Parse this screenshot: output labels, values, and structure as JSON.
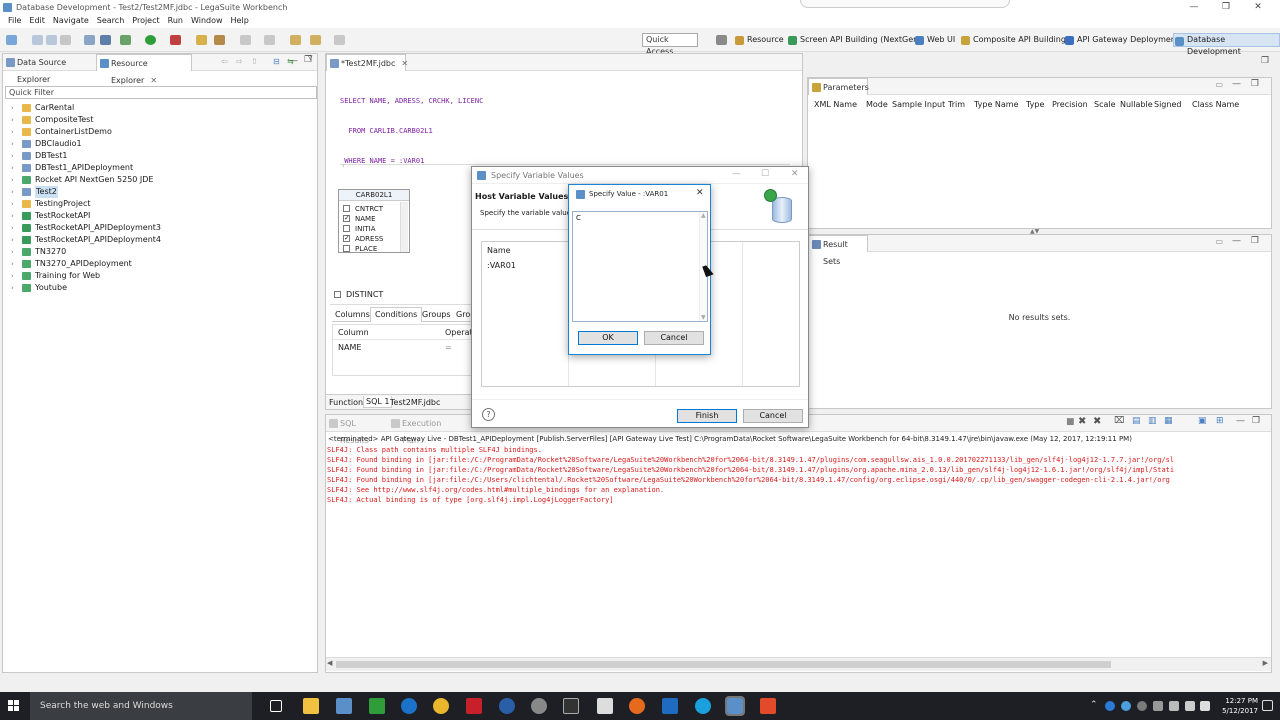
{
  "window": {
    "title": "Database Development - Test2/Test2MF.jdbc - LegaSuite Workbench",
    "minimize": "—",
    "maximize": "❐",
    "close": "✕"
  },
  "menu": [
    "File",
    "Edit",
    "Navigate",
    "Search",
    "Project",
    "Run",
    "Window",
    "Help"
  ],
  "toolbar": {
    "quick_access": "Quick Access",
    "perspectives": [
      {
        "label": "Resource",
        "color": "#c89a3a"
      },
      {
        "label": "Screen API Building (NextGen)",
        "color": "#3a9a5a"
      },
      {
        "label": "Web UI",
        "color": "#4b7fc2"
      },
      {
        "label": "Composite API Building",
        "color": "#c8a23a"
      },
      {
        "label": "API Gateway Deployment",
        "color": "#3a6fc2"
      },
      {
        "label": "Database Development",
        "color": "#5a8fc8"
      }
    ]
  },
  "left_panel": {
    "tabs": [
      "Data Source Explorer",
      "Resource Explorer"
    ],
    "quick_filter": "Quick Filter",
    "projects": [
      "CarRental",
      "CompositeTest",
      "ContainerListDemo",
      "DBClaudio1",
      "DBTest1",
      "DBTest1_APIDeployment",
      "Rocket API NextGen 5250 JDE",
      "Test2",
      "TestingProject",
      "TestRocketAPI",
      "TestRocketAPI_APIDeployment3",
      "TestRocketAPI_APIDeployment4",
      "TN3270",
      "TN3270_APIDeployment",
      "Training for Web",
      "Youtube"
    ],
    "selected_index": 7
  },
  "editor": {
    "tab": "*Test2MF.jdbc",
    "sql_lines": [
      "SELECT NAME, ADRESS, CRCHK, LICENC",
      "  FROM CARLIB.CARB02L1",
      " WHERE NAME = :VAR01"
    ],
    "table_box": {
      "title": "CARB02L1",
      "columns": [
        {
          "name": "CNTRCT",
          "checked": false
        },
        {
          "name": "NAME",
          "checked": true
        },
        {
          "name": "INITIA",
          "checked": false
        },
        {
          "name": "ADRESS",
          "checked": true
        },
        {
          "name": "PLACE",
          "checked": false
        }
      ]
    },
    "distinct_label": "DISTINCT",
    "sub_tabs": [
      "Columns",
      "Conditions",
      "Groups",
      "Grou"
    ],
    "conditions_headers": [
      "Column",
      "Operato"
    ],
    "conditions_row": [
      "NAME",
      "="
    ],
    "bottom_tabs": [
      "Function",
      "SQL 1",
      "Test2MF.jdbc"
    ]
  },
  "parameters": {
    "tab": "Parameters",
    "headers": [
      "XML Name",
      "Mode",
      "Sample Input",
      "Trim",
      "Type Name",
      "Type",
      "Precision",
      "Scale",
      "Nullable",
      "Signed",
      "Class Name"
    ]
  },
  "result_sets": {
    "tab": "Result Sets",
    "empty": "No results sets."
  },
  "console": {
    "tabs": [
      "SQL Results",
      "Execution Plan"
    ],
    "terminated": "<terminated> API Gateway Live - DBTest1_APIDeployment [Publish.ServerFiles] [API Gateway Live Test] C:\\ProgramData\\Rocket Software\\LegaSuite Workbench for 64-bit\\8.3149.1.47\\jre\\bin\\javaw.exe (May 12, 2017, 12:19:11 PM)",
    "lines": [
      "SLF4J: Class path contains multiple SLF4J bindings.",
      "SLF4J: Found binding in [jar:file:/C:/ProgramData/Rocket%20Software/LegaSuite%20Workbench%20for%2064-bit/8.3149.1.47/plugins/com.seagullsw.ais_1.0.0.201702271133/lib_gen/slf4j-log4j12-1.7.7.jar!/org/sl",
      "SLF4J: Found binding in [jar:file:/C:/ProgramData/Rocket%20Software/LegaSuite%20Workbench%20for%2064-bit/8.3149.1.47/plugins/org.apache.mina_2.0.13/lib_gen/slf4j-log4j12-1.6.1.jar!/org/slf4j/impl/Stati",
      "SLF4J: Found binding in [jar:file:/C:/Users/clichtental/.Rocket%20Software/LegaSuite%20Workbench%20for%2064-bit/8.3149.1.47/config/org.eclipse.osgi/440/0/.cp/lib_gen/swagger-codegen-cli-2.1.4.jar!/org",
      "SLF4J: See http://www.slf4j.org/codes.html#multiple_bindings for an explanation.",
      "SLF4J: Actual binding is of type [org.slf4j.impl.Log4jLoggerFactory]"
    ]
  },
  "host_dialog": {
    "title": "Specify Variable Values",
    "heading": "Host Variable Values",
    "subtitle": "Specify the variable value",
    "table_headers": [
      "Name"
    ],
    "rows": [
      ":VAR01"
    ],
    "help": "?",
    "finish": "Finish",
    "cancel": "Cancel"
  },
  "value_dialog": {
    "title": "Specify Value - :VAR01",
    "value": "C",
    "ok": "OK",
    "cancel": "Cancel"
  },
  "taskbar": {
    "search": "Search the web and Windows",
    "time": "12:27 PM",
    "date": "5/12/2017"
  }
}
